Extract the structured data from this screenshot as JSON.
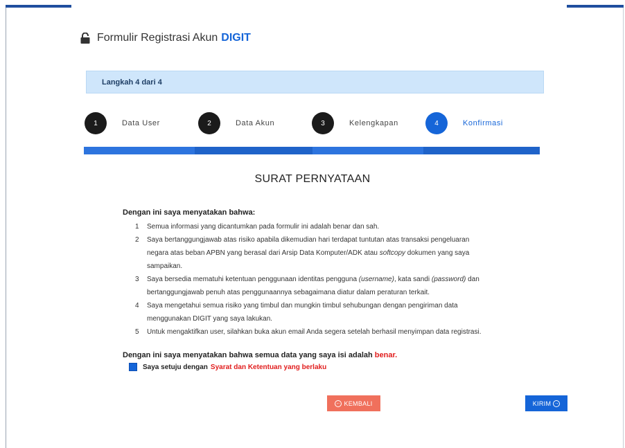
{
  "form": {
    "title": "Formulir Registrasi Akun",
    "brand": "DIGIT",
    "step_banner": "Langkah 4 dari 4"
  },
  "steps": [
    {
      "num": "1",
      "label": "Data User",
      "active": false
    },
    {
      "num": "2",
      "label": "Data Akun",
      "active": false
    },
    {
      "num": "3",
      "label": "Kelengkapan",
      "active": false
    },
    {
      "num": "4",
      "label": "Konfirmasi",
      "active": true
    }
  ],
  "progress_percent": 100,
  "statement": {
    "heading": "SURAT PERNYATAAN",
    "intro": "Dengan ini saya menyatakan bahwa:",
    "items": [
      {
        "num": "1",
        "text": "Semua informasi yang dicantumkan pada formulir ini adalah benar dan sah."
      },
      {
        "num": "2",
        "text_a": "Saya bertanggungjawab atas risiko apabila dikemudian hari terdapat tuntutan atas transaksi pengeluaran",
        "text_b": "negara atas beban APBN yang berasal dari Arsip Data Komputer/ADK atau",
        "text_b_italic": "softcopy",
        "text_b_end": "dokumen yang saya",
        "text_c": "sampaikan."
      },
      {
        "num": "3",
        "text_a1": "Saya bersedia mematuhi ketentuan penggunaan identitas pengguna",
        "text_a_it1": "(username)",
        "text_a2": ", kata sandi",
        "text_a_it2": "(password)",
        "text_a3": "dan",
        "text_b": "bertanggungjawab penuh atas penggunaannya sebagaimana diatur dalam peraturan terkait."
      },
      {
        "num": "4",
        "text_a": "Saya mengetahui semua risiko yang timbul dan mungkin timbul sehubungan dengan pengiriman data",
        "text_b": "menggunakan DIGIT yang saya lakukan."
      },
      {
        "num": "5",
        "text": "Untuk mengaktifkan user, silahkan buka akun email Anda segera setelah berhasil menyimpan data registrasi."
      }
    ],
    "confirm_text": "Dengan ini saya menyatakan bahwa semua data yang saya isi adalah",
    "confirm_highlight": "benar.",
    "agree_text": "Saya setuju dengan",
    "agree_link": "Syarat dan Ketentuan yang berlaku",
    "agree_checked": true
  },
  "buttons": {
    "back": "KEMBALI",
    "send": "KIRIM"
  },
  "colors": {
    "accent": "#1565d8",
    "danger": "#e11d1d",
    "back_button": "#f0705c",
    "banner": "#cfe6fb"
  }
}
